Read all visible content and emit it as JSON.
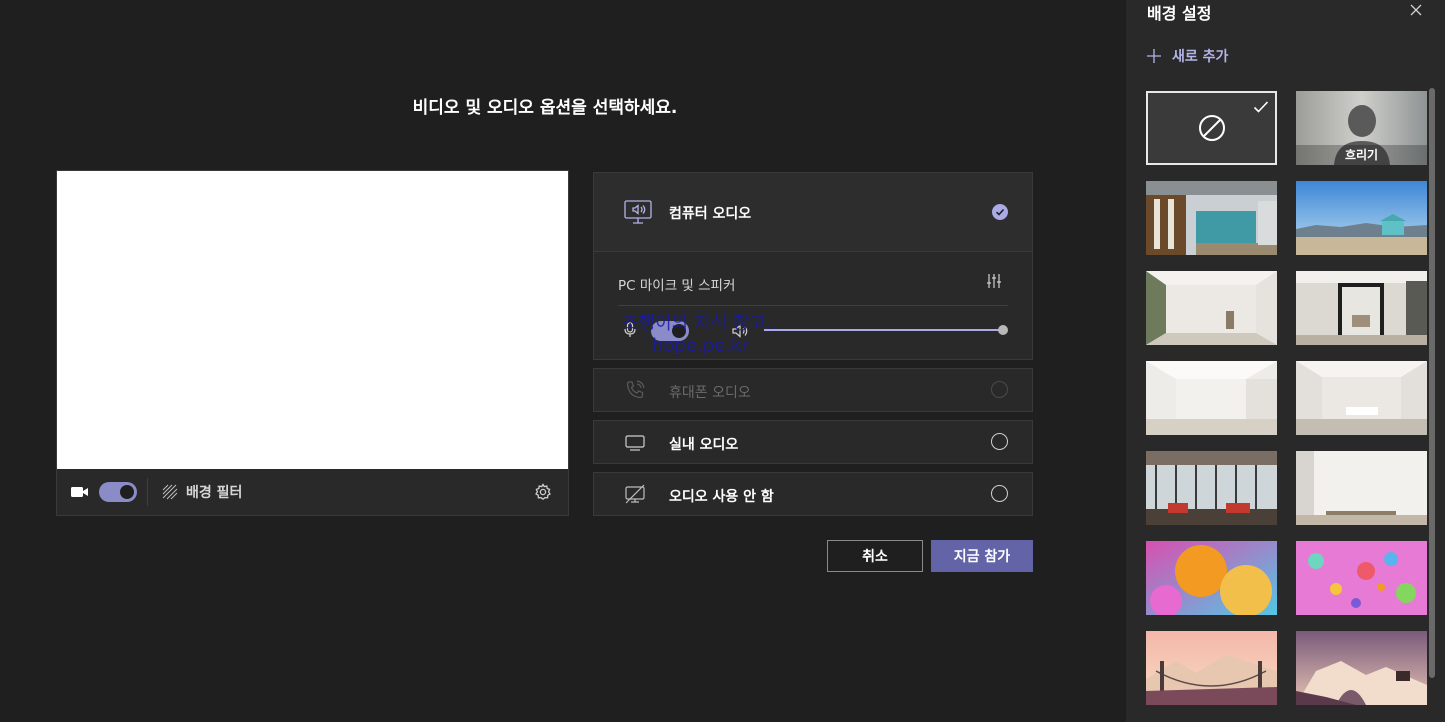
{
  "main": {
    "headline": "비디오 및 오디오 옵션을 선택하세요."
  },
  "video": {
    "camera_on": true,
    "bg_filter_label": "배경 필터"
  },
  "audio": {
    "computer_audio": "컴퓨터 오디오",
    "computer_audio_selected": true,
    "device_label": "PC 마이크 및 스피커",
    "mic_on": true,
    "speaker_volume_fraction": 1.0,
    "phone_audio": "휴대폰 오디오",
    "room_audio": "실내 오디오",
    "no_audio": "오디오 사용 안 함"
  },
  "watermark": {
    "line1": "조행이의 지식 창고..",
    "line2": "hope.pe.kr"
  },
  "buttons": {
    "cancel": "취소",
    "join": "지금 참가"
  },
  "panel": {
    "title": "배경 설정",
    "add_new": "새로 추가",
    "tiles": [
      {
        "label": "",
        "type": "none",
        "selected": true
      },
      {
        "label": "흐리기",
        "type": "blur"
      },
      {
        "label": "",
        "type": "office"
      },
      {
        "label": "",
        "type": "beach"
      },
      {
        "label": "",
        "type": "room-white-1"
      },
      {
        "label": "",
        "type": "room-white-2"
      },
      {
        "label": "",
        "type": "room-white-3"
      },
      {
        "label": "",
        "type": "room-white-4"
      },
      {
        "label": "",
        "type": "loft"
      },
      {
        "label": "",
        "type": "white-wall"
      },
      {
        "label": "",
        "type": "orange-spheres"
      },
      {
        "label": "",
        "type": "pink-bubbles"
      },
      {
        "label": "",
        "type": "bridge"
      },
      {
        "label": "",
        "type": "arch"
      }
    ]
  },
  "colors": {
    "accent": "#6264a7",
    "accent_light": "#a9aae6",
    "background": "#1f1f1f",
    "panel": "#292929"
  }
}
